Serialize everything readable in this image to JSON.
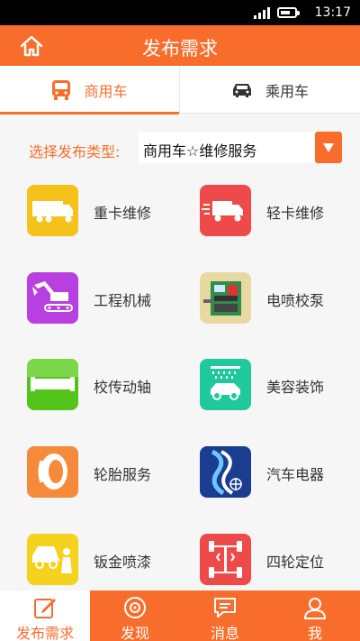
{
  "status_bar": {
    "time": "13:17"
  },
  "app_bar": {
    "title": "发布需求",
    "home_icon": "home-icon"
  },
  "tabs": [
    {
      "label": "商用车",
      "icon": "bus-icon",
      "active": true
    },
    {
      "label": "乘用车",
      "icon": "car-icon",
      "active": false
    }
  ],
  "type_selector": {
    "label": "选择发布类型:",
    "value": "商用车☆维修服务"
  },
  "services": [
    {
      "label": "重卡维修",
      "icon": "heavy-truck-icon",
      "color": "#f5c21b"
    },
    {
      "label": "轻卡维修",
      "icon": "light-truck-icon",
      "color": "#ef4a4a"
    },
    {
      "label": "工程机械",
      "icon": "excavator-icon",
      "color": "#b83fe0"
    },
    {
      "label": "电喷校泵",
      "icon": "pump-bench-icon",
      "color": "#e8d9a0"
    },
    {
      "label": "校传动轴",
      "icon": "drive-shaft-icon",
      "color": "#52c41a"
    },
    {
      "label": "美容装饰",
      "icon": "car-wash-icon",
      "color": "#1fc99b"
    },
    {
      "label": "轮胎服务",
      "icon": "tire-icon",
      "color": "#f58a3a"
    },
    {
      "label": "汽车电器",
      "icon": "electrical-icon",
      "color": "#1a3d8f"
    },
    {
      "label": "钣金喷漆",
      "icon": "spray-paint-icon",
      "color": "#f5d21b"
    },
    {
      "label": "四轮定位",
      "icon": "wheel-alignment-icon",
      "color": "#ef4a4a"
    }
  ],
  "bottom_nav": [
    {
      "label": "发布需求",
      "icon": "edit-icon",
      "active": true
    },
    {
      "label": "发现",
      "icon": "discover-icon",
      "active": false
    },
    {
      "label": "消息",
      "icon": "message-icon",
      "active": false
    },
    {
      "label": "我",
      "icon": "user-icon",
      "active": false
    }
  ]
}
